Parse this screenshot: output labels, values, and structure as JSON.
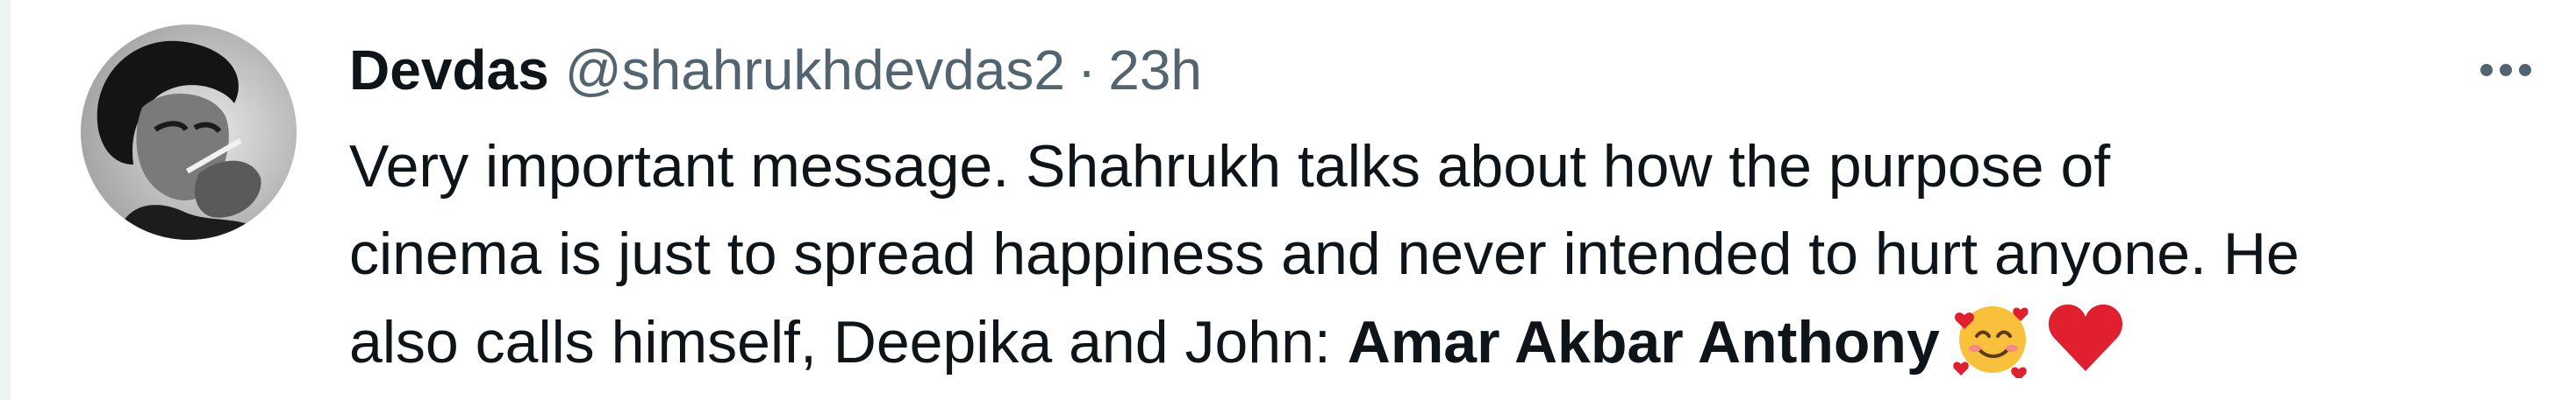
{
  "tweet": {
    "display_name": "Devdas",
    "handle": "@shahrukhdevdas2",
    "separator": "·",
    "timestamp": "23h",
    "text_lines": [
      "Very important message. Shahrukh talks about how the purpose of",
      "cinema is just to spread happiness and never intended to hurt anyone. He",
      "also calls himself, Deepika and John: "
    ],
    "bold_text": "Amar Akbar Anthony",
    "emojis": [
      "smiling-face-with-hearts-emoji",
      "red-heart-emoji"
    ],
    "more_icon": "more-options-icon",
    "avatar_icon": "profile-photo"
  },
  "colors": {
    "text_primary": "#0f1419",
    "text_secondary": "#536471",
    "heart_red": "#e0202f",
    "emoji_yellow": "#f9c03b"
  }
}
